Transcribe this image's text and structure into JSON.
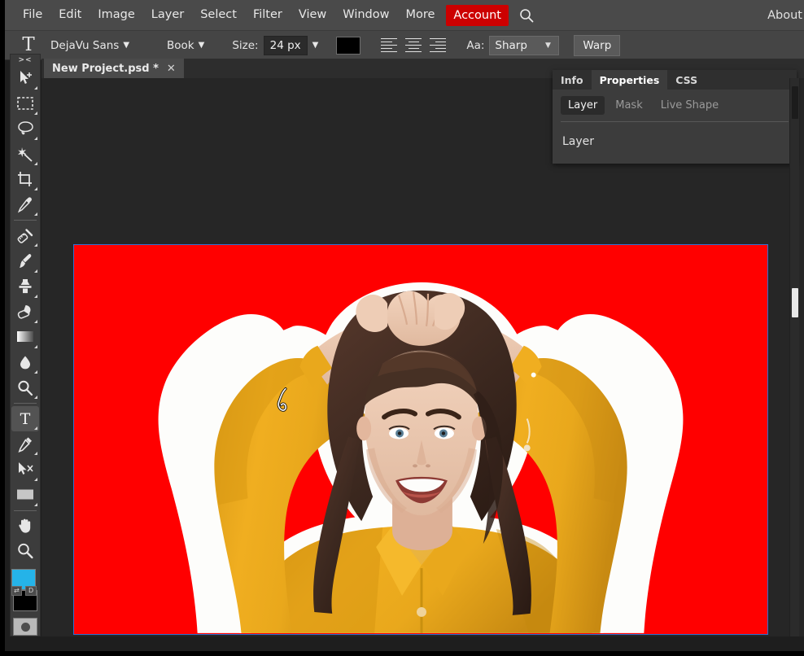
{
  "app": {
    "theme_bg": "#1e1e1e",
    "accent_red": "#cc0000",
    "selection_blue": "#2f6fd0"
  },
  "menubar": {
    "items": [
      {
        "label": "File"
      },
      {
        "label": "Edit"
      },
      {
        "label": "Image"
      },
      {
        "label": "Layer"
      },
      {
        "label": "Select"
      },
      {
        "label": "Filter"
      },
      {
        "label": "View"
      },
      {
        "label": "Window"
      },
      {
        "label": "More"
      }
    ],
    "account_label": "Account",
    "search_icon": "search-icon",
    "right_items": [
      {
        "label": "About"
      }
    ]
  },
  "options_bar": {
    "tool_icon": "text-tool-icon",
    "tool_glyph": "T",
    "font_family": "DejaVu Sans",
    "font_style": "Book",
    "size_label": "Size:",
    "size_value": "24 px",
    "color_swatch": "#000000",
    "align_left": "align-left",
    "align_center": "align-center",
    "align_right": "align-right",
    "aa_label": "Aa:",
    "aa_value": "Sharp",
    "warp_label": "Warp",
    "caret": "▼"
  },
  "toolbar": {
    "grip": "><",
    "tools": [
      {
        "name": "move-tool",
        "active": false
      },
      {
        "name": "rectangular-marquee-tool",
        "active": false
      },
      {
        "name": "lasso-tool",
        "active": false
      },
      {
        "name": "magic-wand-tool",
        "active": false
      },
      {
        "name": "crop-tool",
        "active": false
      },
      {
        "name": "eyedropper-tool",
        "active": false
      },
      {
        "name": "spot-healing-brush-tool",
        "active": false
      },
      {
        "name": "brush-tool",
        "active": false
      },
      {
        "name": "clone-stamp-tool",
        "active": false
      },
      {
        "name": "eraser-tool",
        "active": false
      },
      {
        "name": "gradient-tool",
        "active": false
      },
      {
        "name": "blur-tool",
        "active": false
      },
      {
        "name": "dodge-tool",
        "active": false
      },
      {
        "name": "type-tool",
        "active": true
      },
      {
        "name": "pen-tool",
        "active": false
      },
      {
        "name": "path-selection-tool",
        "active": false
      },
      {
        "name": "rectangle-tool",
        "active": false
      },
      {
        "name": "hand-tool",
        "active": false
      },
      {
        "name": "zoom-tool",
        "active": false
      }
    ],
    "foreground_color": "#25b3e8",
    "background_color": "#000000",
    "swap_colors_label": "⇄",
    "default_colors_label": "D",
    "quick_mask": "quick-mask-toggle"
  },
  "document": {
    "tab_label": "New Project.psd *",
    "close_label": "✕",
    "canvas_bg_color": "#ff0000",
    "canvas_selected": true
  },
  "panel": {
    "tabs": [
      {
        "label": "Info",
        "active": false
      },
      {
        "label": "Properties",
        "active": true
      },
      {
        "label": "CSS",
        "active": false
      }
    ],
    "subtabs": [
      {
        "label": "Layer",
        "active": true
      },
      {
        "label": "Mask",
        "active": false
      },
      {
        "label": "Live Shape",
        "active": false
      }
    ],
    "row_label": "Layer"
  },
  "scrollbar": {
    "name": "vertical-scrollbar"
  }
}
